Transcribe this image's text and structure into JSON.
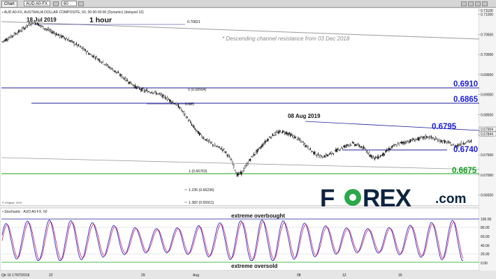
{
  "toolbar": {
    "chart_button": "Chart",
    "symbol_value": "AUD A0-FX",
    "interval_value": "60"
  },
  "main_panel": {
    "title": "• AUD A0-FX, AUSTRALIA DOLLAR COMPOSITE, 60, 00:00-00:00 (Dynamic) (delayed 16)",
    "timeframe_label": "1 hour",
    "annotation_high": "18 Jul 2019",
    "annotation_aug8": "08 Aug 2019",
    "channel_note": "* Descending channel resistance from 03 Dec 2018",
    "levels": [
      "0.6910",
      "0.6865",
      "0.6795",
      "0.6740",
      "0.6675"
    ],
    "fib_labels": [
      "0.70821",
      "0 (0.68994)",
      "0.685",
      "1 (0.66763)",
      "1.236 (0.66236)",
      "1.382 (0.65911)"
    ],
    "last_price_tag": "0.67904",
    "last_price_tag2": "0.67844",
    "credit": "© eSignal, 2019"
  },
  "stoch_panel": {
    "title": "• Stochastic - AUD A0-FX, 60",
    "overbought_label": "extreme overbought",
    "oversold_label": "extreme oversold",
    "ticks": [
      "100.00",
      "80.00",
      "60.00",
      "40.00",
      "20.00",
      "0.00"
    ]
  },
  "x_axis": {
    "start_label": "Qtr 16 17/07/2019",
    "labels": [
      "22",
      "29",
      "Aug",
      "08",
      "12",
      "16"
    ]
  },
  "logo": {
    "text_before": "F",
    "text_after": "REX",
    "suffix": ".com"
  },
  "chart_data": {
    "type": "line",
    "title": "AUD A0-FX, AUSTRALIA DOLLAR COMPOSITE, 60",
    "x_tick_labels": [
      "22",
      "29",
      "Aug",
      "08",
      "12",
      "16"
    ],
    "y_ticks": [
      "0.71100",
      "0.71000",
      "0.70500",
      "0.70000",
      "0.69500",
      "0.69000",
      "0.68500",
      "0.68000",
      "0.67500",
      "0.67000",
      "0.66500"
    ],
    "ylim": [
      0.6625,
      0.7115
    ],
    "series": [
      {
        "x": [
          0,
          3,
          6,
          9,
          12,
          15,
          18,
          21,
          24,
          27,
          30,
          33,
          36,
          39,
          42,
          45,
          48,
          51,
          54,
          57,
          60,
          63,
          66,
          69,
          72,
          75,
          78,
          81,
          84,
          87,
          90,
          93,
          96,
          99,
          102,
          105,
          108,
          111,
          114,
          117,
          120,
          123,
          126,
          129,
          132,
          135,
          138,
          141,
          144,
          147,
          150,
          153,
          156,
          159,
          162,
          165,
          168,
          171,
          174,
          177,
          180,
          183,
          186,
          189,
          192,
          195,
          198,
          201,
          204,
          207,
          210,
          213,
          216,
          219,
          222,
          225,
          228,
          231,
          234,
          237,
          240,
          243,
          246,
          249,
          252,
          255,
          258,
          261,
          264,
          267,
          270,
          273,
          276,
          279,
          282,
          285,
          288,
          291,
          294,
          297,
          300,
          303,
          306,
          309,
          312,
          315,
          318
        ],
        "values": [
          0.7032,
          0.7038,
          0.7044,
          0.7052,
          0.7058,
          0.7066,
          0.7074,
          0.7081,
          0.7077,
          0.7069,
          0.7063,
          0.7058,
          0.7053,
          0.7046,
          0.7043,
          0.7036,
          0.703,
          0.7023,
          0.7016,
          0.7008,
          0.6999,
          0.6994,
          0.6986,
          0.6979,
          0.697,
          0.6962,
          0.6954,
          0.6946,
          0.6937,
          0.6929,
          0.692,
          0.6915,
          0.691,
          0.6908,
          0.6907,
          0.6903,
          0.6898,
          0.6892,
          0.6885,
          0.6878,
          0.6869,
          0.6853,
          0.6838,
          0.6822,
          0.6808,
          0.6797,
          0.6788,
          0.678,
          0.6772,
          0.6768,
          0.6762,
          0.6748,
          0.673,
          0.67,
          0.6705,
          0.6722,
          0.674,
          0.6753,
          0.6765,
          0.6778,
          0.679,
          0.6799,
          0.6805,
          0.6808,
          0.6806,
          0.68,
          0.6794,
          0.6787,
          0.6779,
          0.6768,
          0.6758,
          0.675,
          0.6745,
          0.6748,
          0.6752,
          0.6758,
          0.6765,
          0.677,
          0.6775,
          0.6778,
          0.6775,
          0.677,
          0.6762,
          0.675,
          0.6742,
          0.6745,
          0.6752,
          0.6762,
          0.677,
          0.6775,
          0.678,
          0.6782,
          0.6785,
          0.6788,
          0.679,
          0.6793,
          0.6795,
          0.6792,
          0.6788,
          0.6785,
          0.6782,
          0.6778,
          0.6772,
          0.6775,
          0.678,
          0.6783,
          0.6784
        ]
      }
    ],
    "grid": false
  }
}
